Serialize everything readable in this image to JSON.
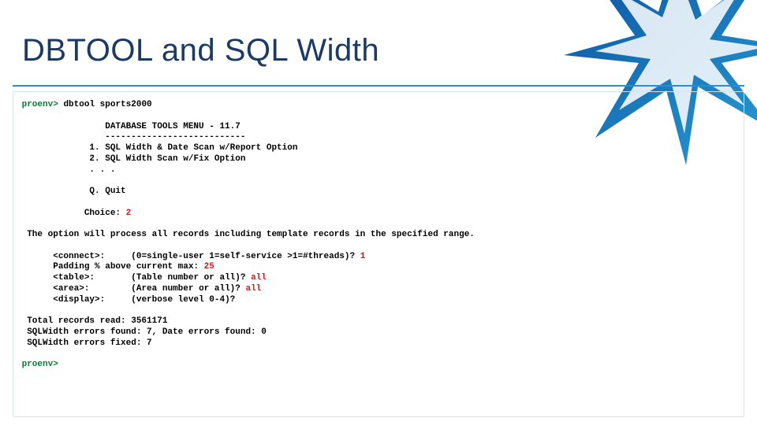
{
  "title": "DBTOOL and SQL Width",
  "term": {
    "prompt1": "proenv>",
    "command1": "dbtool sports2000",
    "menu_header": "DATABASE TOOLS MENU - 11.7",
    "menu_divider": "---------------------------",
    "menu_item1": "1. SQL Width & Date Scan w/Report Option",
    "menu_item2": "2. SQL Width Scan w/Fix Option",
    "menu_ellipsis": ". . .",
    "menu_quit": "Q. Quit",
    "choice_label": "Choice: ",
    "choice_value": "2",
    "option_desc": "The option will process all records including template records in the specified range.",
    "connect_label": "<connect>:",
    "connect_value": "(0=single-user 1=self-service >1=#threads)? ",
    "connect_answer": "1",
    "padding_label": "Padding % above current max: ",
    "padding_value": "25",
    "table_label": "<table>:",
    "table_value": "(Table number or all)? ",
    "table_answer": "all",
    "area_label": "<area>:",
    "area_value": "(Area number or all)? ",
    "area_answer": "all",
    "display_label": "<display>:",
    "display_value": "(verbose level 0-4)?",
    "result1": "Total records read: 3561171",
    "result2": "SQLWidth errors found: 7, Date errors found: 0",
    "result3": "SQLWidth errors fixed: 7",
    "prompt2": "proenv>"
  }
}
